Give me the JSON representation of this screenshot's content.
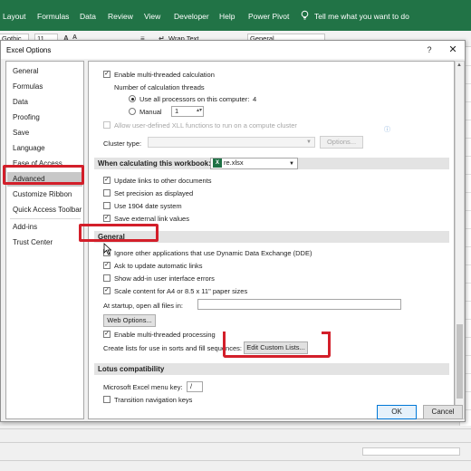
{
  "ribbon": {
    "tabs": [
      "Layout",
      "Formulas",
      "Data",
      "Review",
      "View",
      "Developer",
      "Help",
      "Power Pivot"
    ],
    "tell_me": "Tell me what you want to do",
    "font_name": "Gothic",
    "font_size": "11",
    "wrap_text": "Wrap Text",
    "number_format": "General"
  },
  "dialog": {
    "title": "Excel Options",
    "help_glyph": "?",
    "close_glyph": "✕",
    "ok_label": "OK",
    "cancel_label": "Cancel"
  },
  "nav": {
    "items": [
      "General",
      "Formulas",
      "Data",
      "Proofing",
      "Save",
      "Language",
      "Ease of Access",
      "Advanced",
      "Customize Ribbon",
      "Quick Access Toolbar",
      "Add-ins",
      "Trust Center"
    ],
    "selected": "Advanced"
  },
  "advanced": {
    "multithread_calc": {
      "label": "Enable multi-threaded calculation",
      "checked": true
    },
    "calc_threads_label": "Number of calculation threads",
    "use_all_processors_label": "Use all processors on this computer:",
    "processor_count": "4",
    "manual_label": "Manual",
    "manual_value": "1",
    "xll_label": "Allow user-defined XLL functions to run on a compute cluster",
    "cluster_type_label": "Cluster type:",
    "options_button": "Options...",
    "workbook_section": "When calculating this workbook:",
    "workbook_name": "re.xlsx",
    "workbook_options": [
      {
        "label": "Update links to other documents",
        "checked": true
      },
      {
        "label": "Set precision as displayed",
        "checked": false
      },
      {
        "label": "Use 1904 date system",
        "checked": false
      },
      {
        "label": "Save external link values",
        "checked": true
      }
    ],
    "general_section": "General",
    "general_options": [
      {
        "label": "Ignore other applications that use Dynamic Data Exchange (DDE)",
        "checked": false
      },
      {
        "label": "Ask to update automatic links",
        "checked": true
      },
      {
        "label": "Show add-in user interface errors",
        "checked": false
      },
      {
        "label": "Scale content for A4 or 8.5 x 11\" paper sizes",
        "checked": true
      }
    ],
    "startup_label": "At startup, open all files in:",
    "web_options_button": "Web Options...",
    "multithread_processing": {
      "label": "Enable multi-threaded processing",
      "checked": true
    },
    "create_lists_label": "Create lists for use in sorts and fill sequences:",
    "edit_custom_lists_button": "Edit Custom Lists...",
    "lotus_section": "Lotus compatibility",
    "menu_key_label": "Microsoft Excel menu key:",
    "menu_key_value": "/",
    "transition_keys": {
      "label": "Transition navigation keys",
      "checked": false
    }
  },
  "colors": {
    "excel_green": "#217346",
    "highlight_red": "#d31f2a",
    "selected_nav": "#c8c8c8"
  }
}
